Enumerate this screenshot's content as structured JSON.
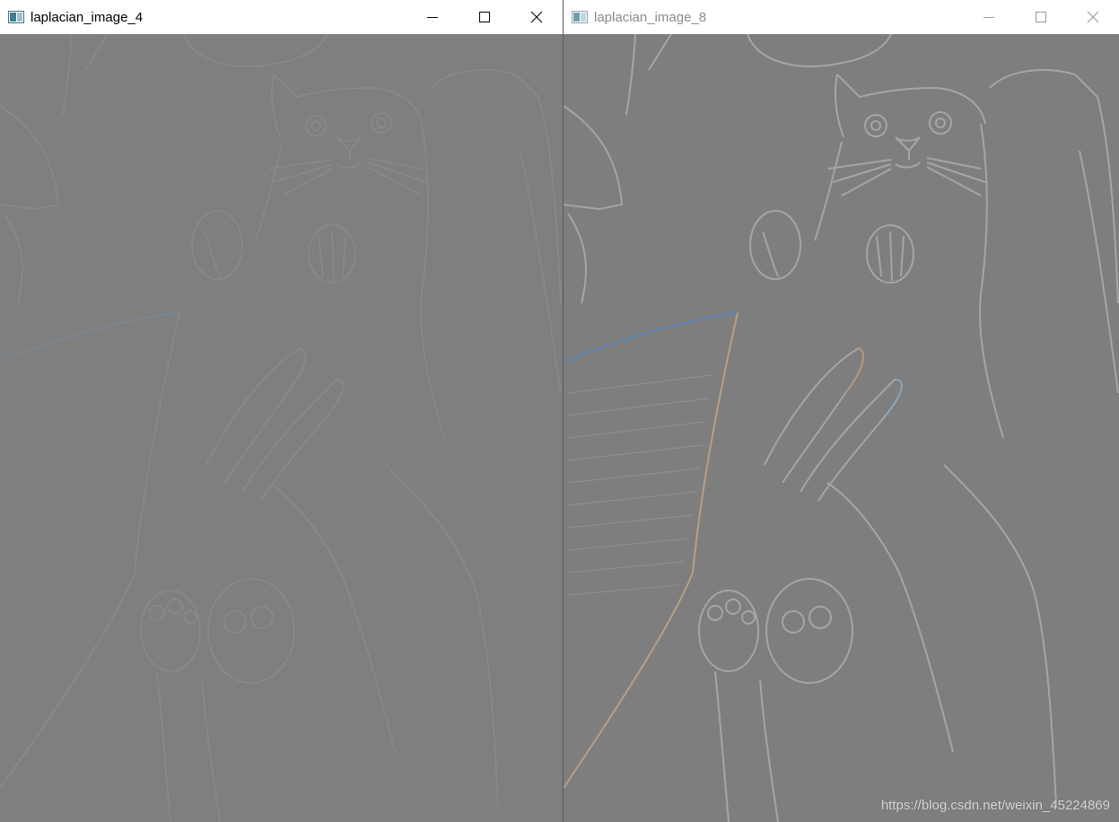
{
  "windows": [
    {
      "title": "laplacian_image_4",
      "state": "active",
      "controls": {
        "minimize": "minimize-icon",
        "maximize": "maximize-icon",
        "close": "close-icon"
      }
    },
    {
      "title": "laplacian_image_8",
      "state": "inactive",
      "controls": {
        "minimize": "minimize-icon",
        "maximize": "maximize-icon",
        "close": "close-icon"
      }
    }
  ],
  "watermark": "https://blog.csdn.net/weixin_45224869",
  "colors": {
    "titlebar": "#ffffff",
    "image_gray": "#7f7f7f",
    "active_title": "#000000",
    "inactive_title": "#8a8a8a"
  }
}
